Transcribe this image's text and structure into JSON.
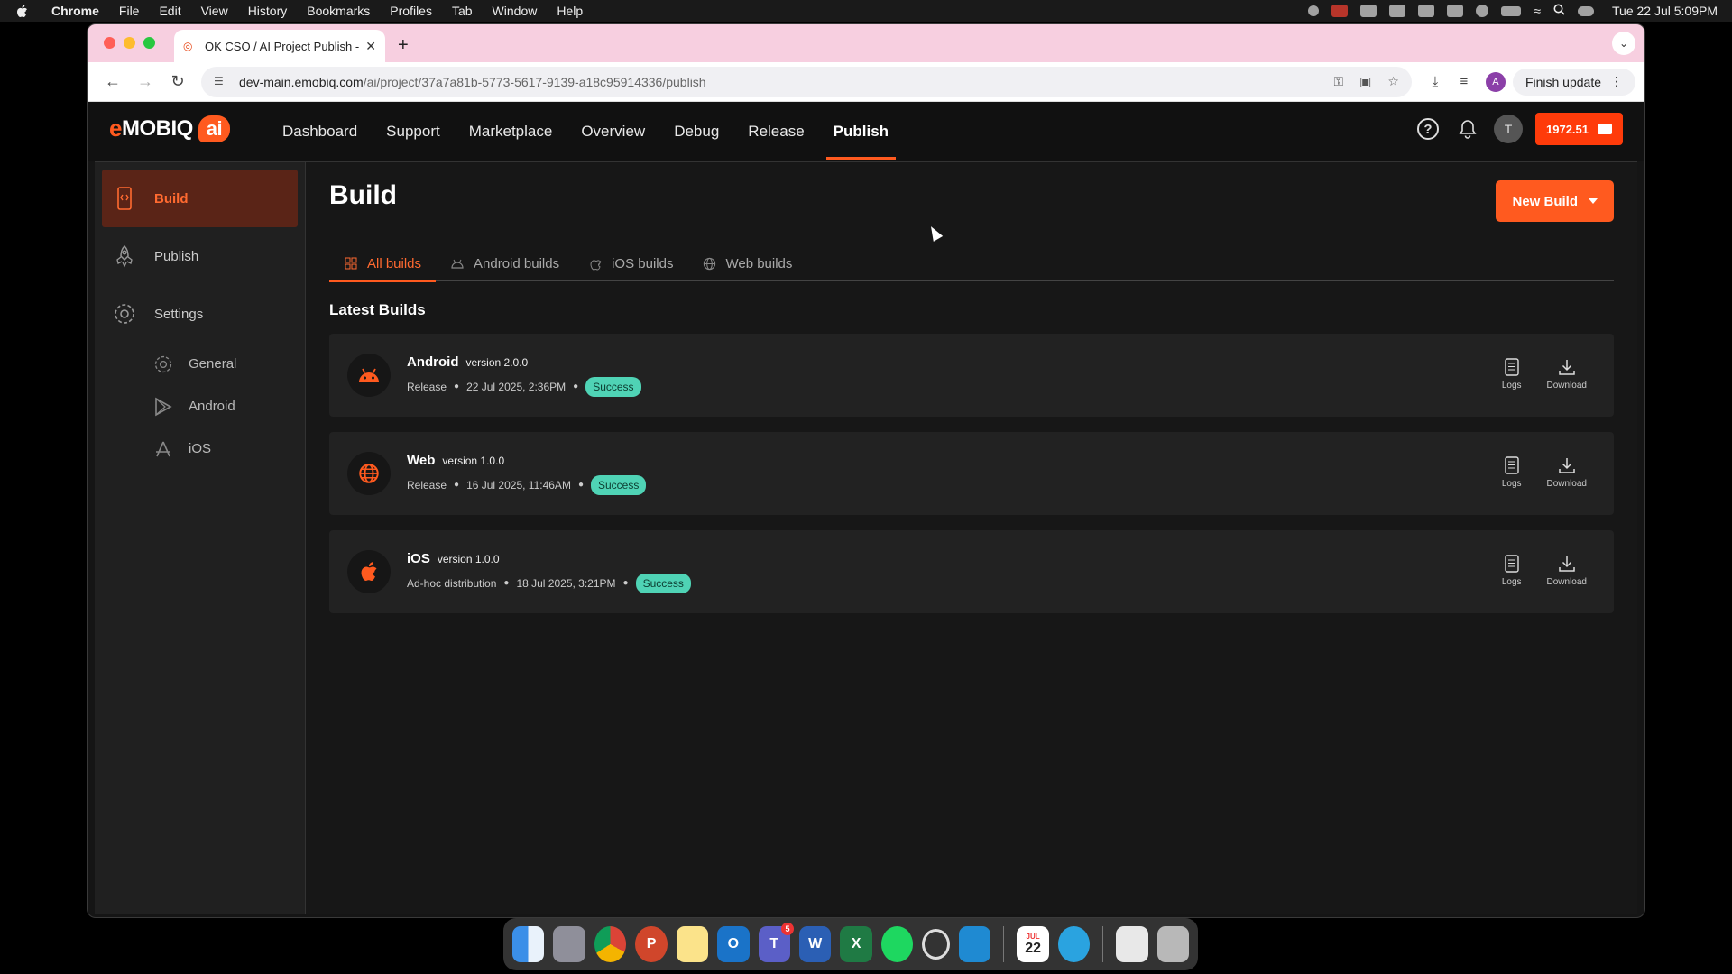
{
  "menubar": {
    "app": "Chrome",
    "items": [
      "File",
      "Edit",
      "View",
      "History",
      "Bookmarks",
      "Profiles",
      "Tab",
      "Window",
      "Help"
    ],
    "clock": "Tue 22 Jul  5:09PM"
  },
  "browser": {
    "tab_title": "OK CSO / AI Project Publish -",
    "url_host": "dev-main.emobiq.com",
    "url_path": "/ai/project/37a7a81b-5773-5617-9139-a18c95914336/publish",
    "profile_initial": "A",
    "finish_update": "Finish update"
  },
  "app": {
    "logo_e": "e",
    "logo_mobiq": "MOBIQ",
    "logo_ai": "ai",
    "nav": [
      "Dashboard",
      "Support",
      "Marketplace",
      "Overview",
      "Debug",
      "Release",
      "Publish"
    ],
    "active_nav": "Publish",
    "user_initial": "T",
    "credits": "1972.51"
  },
  "sidebar": {
    "items": [
      {
        "label": "Build",
        "icon": "phone-build-icon",
        "active": true
      },
      {
        "label": "Publish",
        "icon": "rocket-icon",
        "active": false
      },
      {
        "label": "Settings",
        "icon": "gear-icon",
        "active": false
      }
    ],
    "sub_items": [
      {
        "label": "General",
        "icon": "gear-icon"
      },
      {
        "label": "Android",
        "icon": "play-store-icon"
      },
      {
        "label": "iOS",
        "icon": "app-store-icon"
      }
    ]
  },
  "main": {
    "title": "Build",
    "new_build": "New Build",
    "tabs": [
      {
        "label": "All builds",
        "icon": "grid-icon",
        "active": true
      },
      {
        "label": "Android builds",
        "icon": "android-icon",
        "active": false
      },
      {
        "label": "iOS builds",
        "icon": "apple-icon",
        "active": false
      },
      {
        "label": "Web builds",
        "icon": "globe-icon",
        "active": false
      }
    ],
    "section_title": "Latest Builds",
    "builds": [
      {
        "platform": "Android",
        "version": "version 2.0.0",
        "type": "Release",
        "date": "22 Jul 2025, 2:36PM",
        "status": "Success",
        "icon": "android-icon"
      },
      {
        "platform": "Web",
        "version": "version 1.0.0",
        "type": "Release",
        "date": "16 Jul 2025, 11:46AM",
        "status": "Success",
        "icon": "globe-icon"
      },
      {
        "platform": "iOS",
        "version": "version 1.0.0",
        "type": "Ad-hoc distribution",
        "date": "18 Jul 2025, 3:21PM",
        "status": "Success",
        "icon": "apple-icon"
      }
    ],
    "logs_label": "Logs",
    "download_label": "Download"
  },
  "dock": {
    "teams_badge": "5",
    "calendar_month": "JUL",
    "calendar_day": "22"
  },
  "colors": {
    "accent": "#ff5a1f",
    "success": "#4fd3b5",
    "active_sidebar_bg": "#5a2417"
  }
}
